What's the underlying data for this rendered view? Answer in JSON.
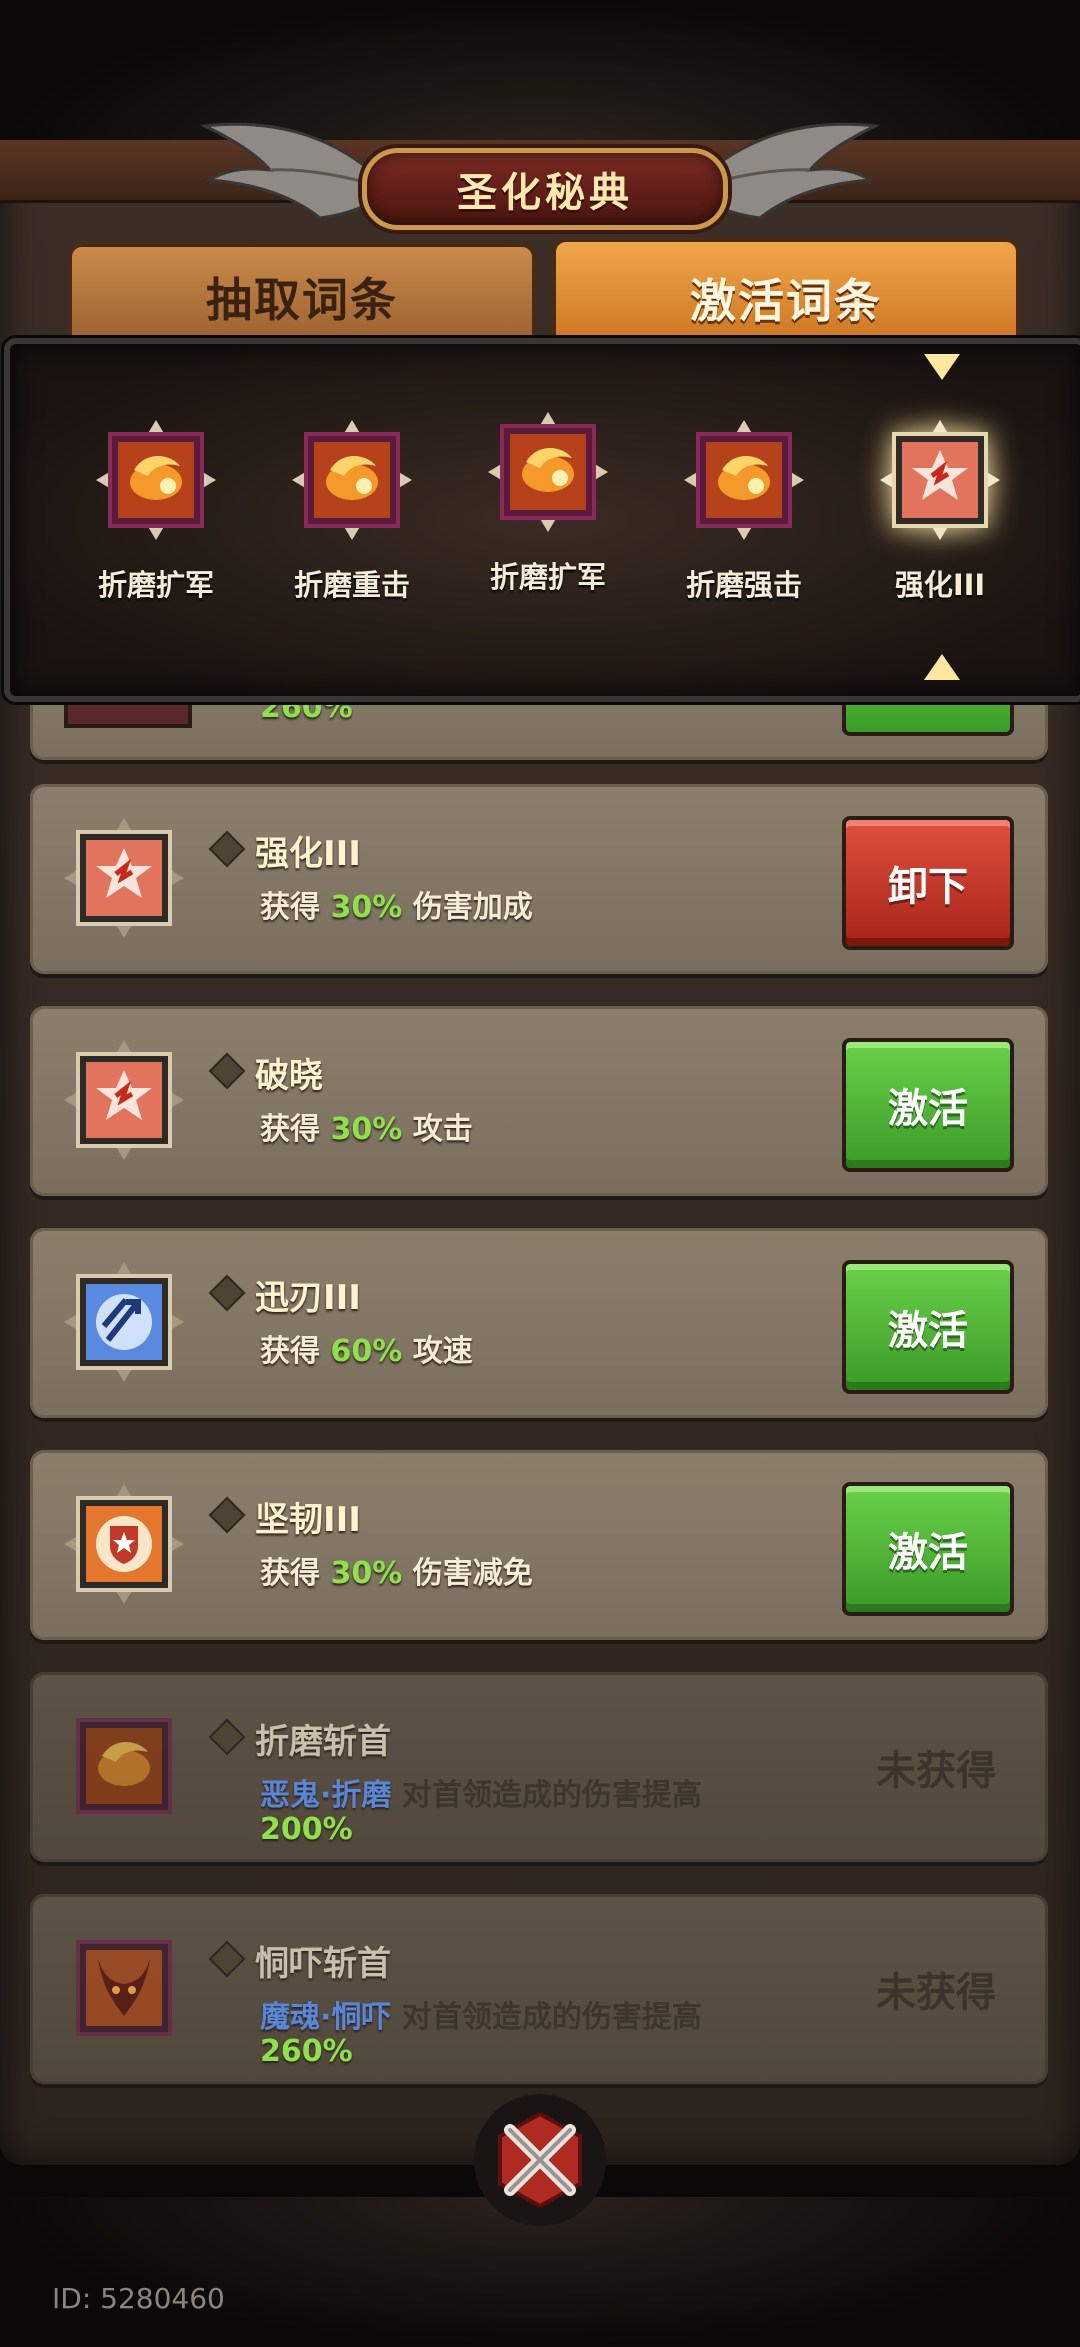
{
  "title": "圣化秘典",
  "tabs": [
    {
      "label": "抽取词条",
      "active": false
    },
    {
      "label": "激活词条",
      "active": true
    }
  ],
  "slots": [
    {
      "label": "折磨扩军",
      "icon": "torment-fire-icon"
    },
    {
      "label": "折磨重击",
      "icon": "torment-fire-icon"
    },
    {
      "label": "折磨扩军",
      "icon": "torment-fire-icon"
    },
    {
      "label": "折磨强击",
      "icon": "torment-fire-icon"
    },
    {
      "label": "强化III",
      "icon": "empower-burst-icon",
      "selected": true
    }
  ],
  "partial_row": {
    "pct": "260%"
  },
  "rows": [
    {
      "name": "强化III",
      "prefix": "获得",
      "pct": "30%",
      "suffix": "伤害加成",
      "button": "卸下",
      "button_color": "#c0392b",
      "icon": "empower-burst-icon"
    },
    {
      "name": "破晓",
      "prefix": "获得",
      "pct": "30%",
      "suffix": "攻击",
      "button": "激活",
      "button_color": "#4caf3a",
      "icon": "empower-burst-icon"
    },
    {
      "name": "迅刃III",
      "prefix": "获得",
      "pct": "60%",
      "suffix": "攻速",
      "button": "激活",
      "button_color": "#4caf3a",
      "icon": "swift-blade-icon"
    },
    {
      "name": "坚韧III",
      "prefix": "获得",
      "pct": "30%",
      "suffix": "伤害减免",
      "button": "激活",
      "button_color": "#4caf3a",
      "icon": "shield-star-icon"
    },
    {
      "name": "折磨斩首",
      "tag": "恶鬼·折磨",
      "suffix": "对首领造成的伤害提高",
      "pct": "200%",
      "status": "未获得",
      "icon": "torment-fire-icon"
    },
    {
      "name": "恫吓斩首",
      "tag": "魔魂·恫吓",
      "suffix": "对首领造成的伤害提高",
      "pct": "260%",
      "status": "未获得",
      "icon": "demon-horn-icon"
    }
  ],
  "footer": {
    "id_text": "ID: 5280460"
  }
}
